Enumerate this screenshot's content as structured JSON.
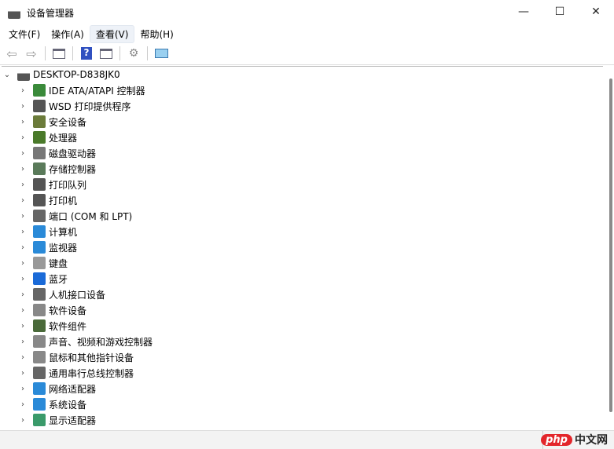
{
  "window": {
    "title": "设备管理器"
  },
  "menu": [
    "文件(F)",
    "操作(A)",
    "查看(V)",
    "帮助(H)"
  ],
  "tree": {
    "root": "DESKTOP-D838JK0",
    "items": [
      {
        "label": "IDE ATA/ATAPI 控制器",
        "color": "#3a8a3a"
      },
      {
        "label": "WSD 打印提供程序",
        "color": "#555"
      },
      {
        "label": "安全设备",
        "color": "#6b7b3a"
      },
      {
        "label": "处理器",
        "color": "#4a7a2a"
      },
      {
        "label": "磁盘驱动器",
        "color": "#777"
      },
      {
        "label": "存储控制器",
        "color": "#5a7a5a"
      },
      {
        "label": "打印队列",
        "color": "#555"
      },
      {
        "label": "打印机",
        "color": "#555"
      },
      {
        "label": "端口 (COM 和 LPT)",
        "color": "#666"
      },
      {
        "label": "计算机",
        "color": "#2a8ad8"
      },
      {
        "label": "监视器",
        "color": "#2a8ad8"
      },
      {
        "label": "键盘",
        "color": "#999"
      },
      {
        "label": "蓝牙",
        "color": "#1a6ad8"
      },
      {
        "label": "人机接口设备",
        "color": "#666"
      },
      {
        "label": "软件设备",
        "color": "#888"
      },
      {
        "label": "软件组件",
        "color": "#4a6a3a"
      },
      {
        "label": "声音、视频和游戏控制器",
        "color": "#888"
      },
      {
        "label": "鼠标和其他指针设备",
        "color": "#888"
      },
      {
        "label": "通用串行总线控制器",
        "color": "#666"
      },
      {
        "label": "网络适配器",
        "color": "#2a8ad8"
      },
      {
        "label": "系统设备",
        "color": "#2a8ad8"
      },
      {
        "label": "显示适配器",
        "color": "#3a9a6a"
      }
    ]
  },
  "watermark": {
    "php": "php",
    "cn": "中文网"
  }
}
